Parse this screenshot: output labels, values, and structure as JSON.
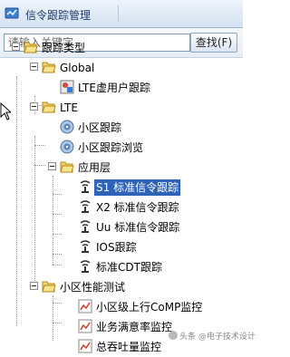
{
  "window": {
    "title": "信令跟踪管理"
  },
  "search": {
    "placeholder": "请输入关键字",
    "button_label": "查找(F)"
  },
  "tree": {
    "root": "跟踪类型",
    "global": "Global",
    "lte_virtual_user": "LTE虚用户跟踪",
    "lte": "LTE",
    "cell_trace": "小区跟踪",
    "cell_trace_browse": "小区跟踪浏览",
    "application_layer": "应用层",
    "s1_trace": "S1 标准信令跟踪",
    "x2_trace": "X2 标准信令跟踪",
    "uu_trace": "Uu 标准信令跟踪",
    "ios_trace": "IOS跟踪",
    "std_cdt_trace": "标准CDT跟踪",
    "cell_perf_test": "小区性能测试",
    "comp_monitor": "小区级上行CoMP监控",
    "satisfaction_monitor": "业务满意率监控",
    "throughput_monitor": "总吞吐量监控",
    "selected": "S1 标准信令跟踪"
  },
  "watermark": "头条 @电子技术设计"
}
